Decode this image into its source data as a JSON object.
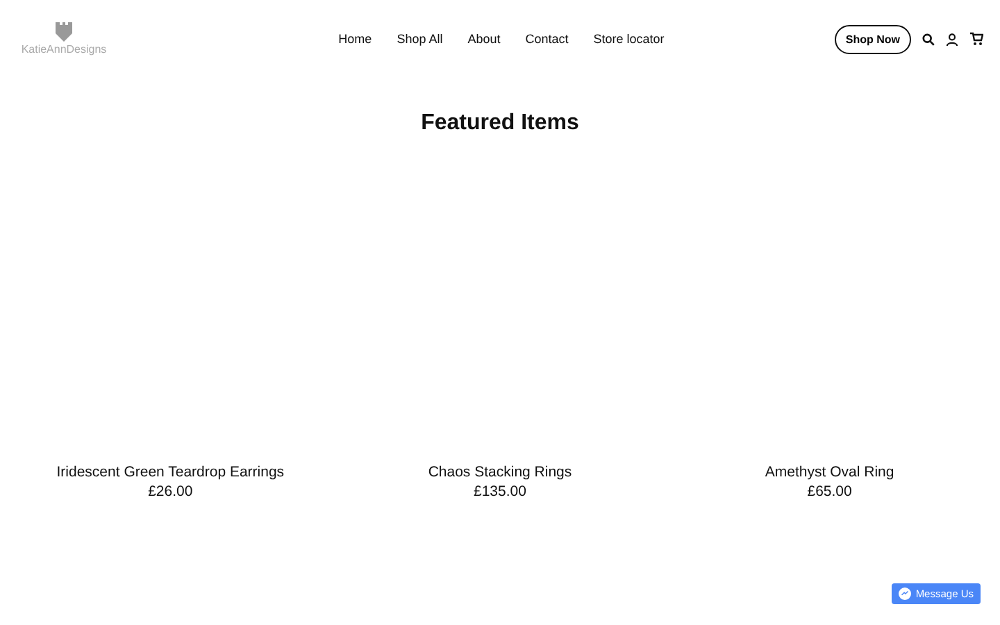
{
  "logo": {
    "text": "KatieAnnDesigns"
  },
  "nav": [
    {
      "label": "Home"
    },
    {
      "label": "Shop All"
    },
    {
      "label": "About"
    },
    {
      "label": "Contact"
    },
    {
      "label": "Store locator"
    }
  ],
  "shop_button": "Shop Now",
  "heading": "Featured Items",
  "products": [
    {
      "name": "Iridescent Green Teardrop Earrings",
      "price": "£26.00"
    },
    {
      "name": "Chaos Stacking Rings",
      "price": "£135.00"
    },
    {
      "name": "Amethyst Oval Ring",
      "price": "£65.00"
    }
  ],
  "chat_button": "Message Us"
}
